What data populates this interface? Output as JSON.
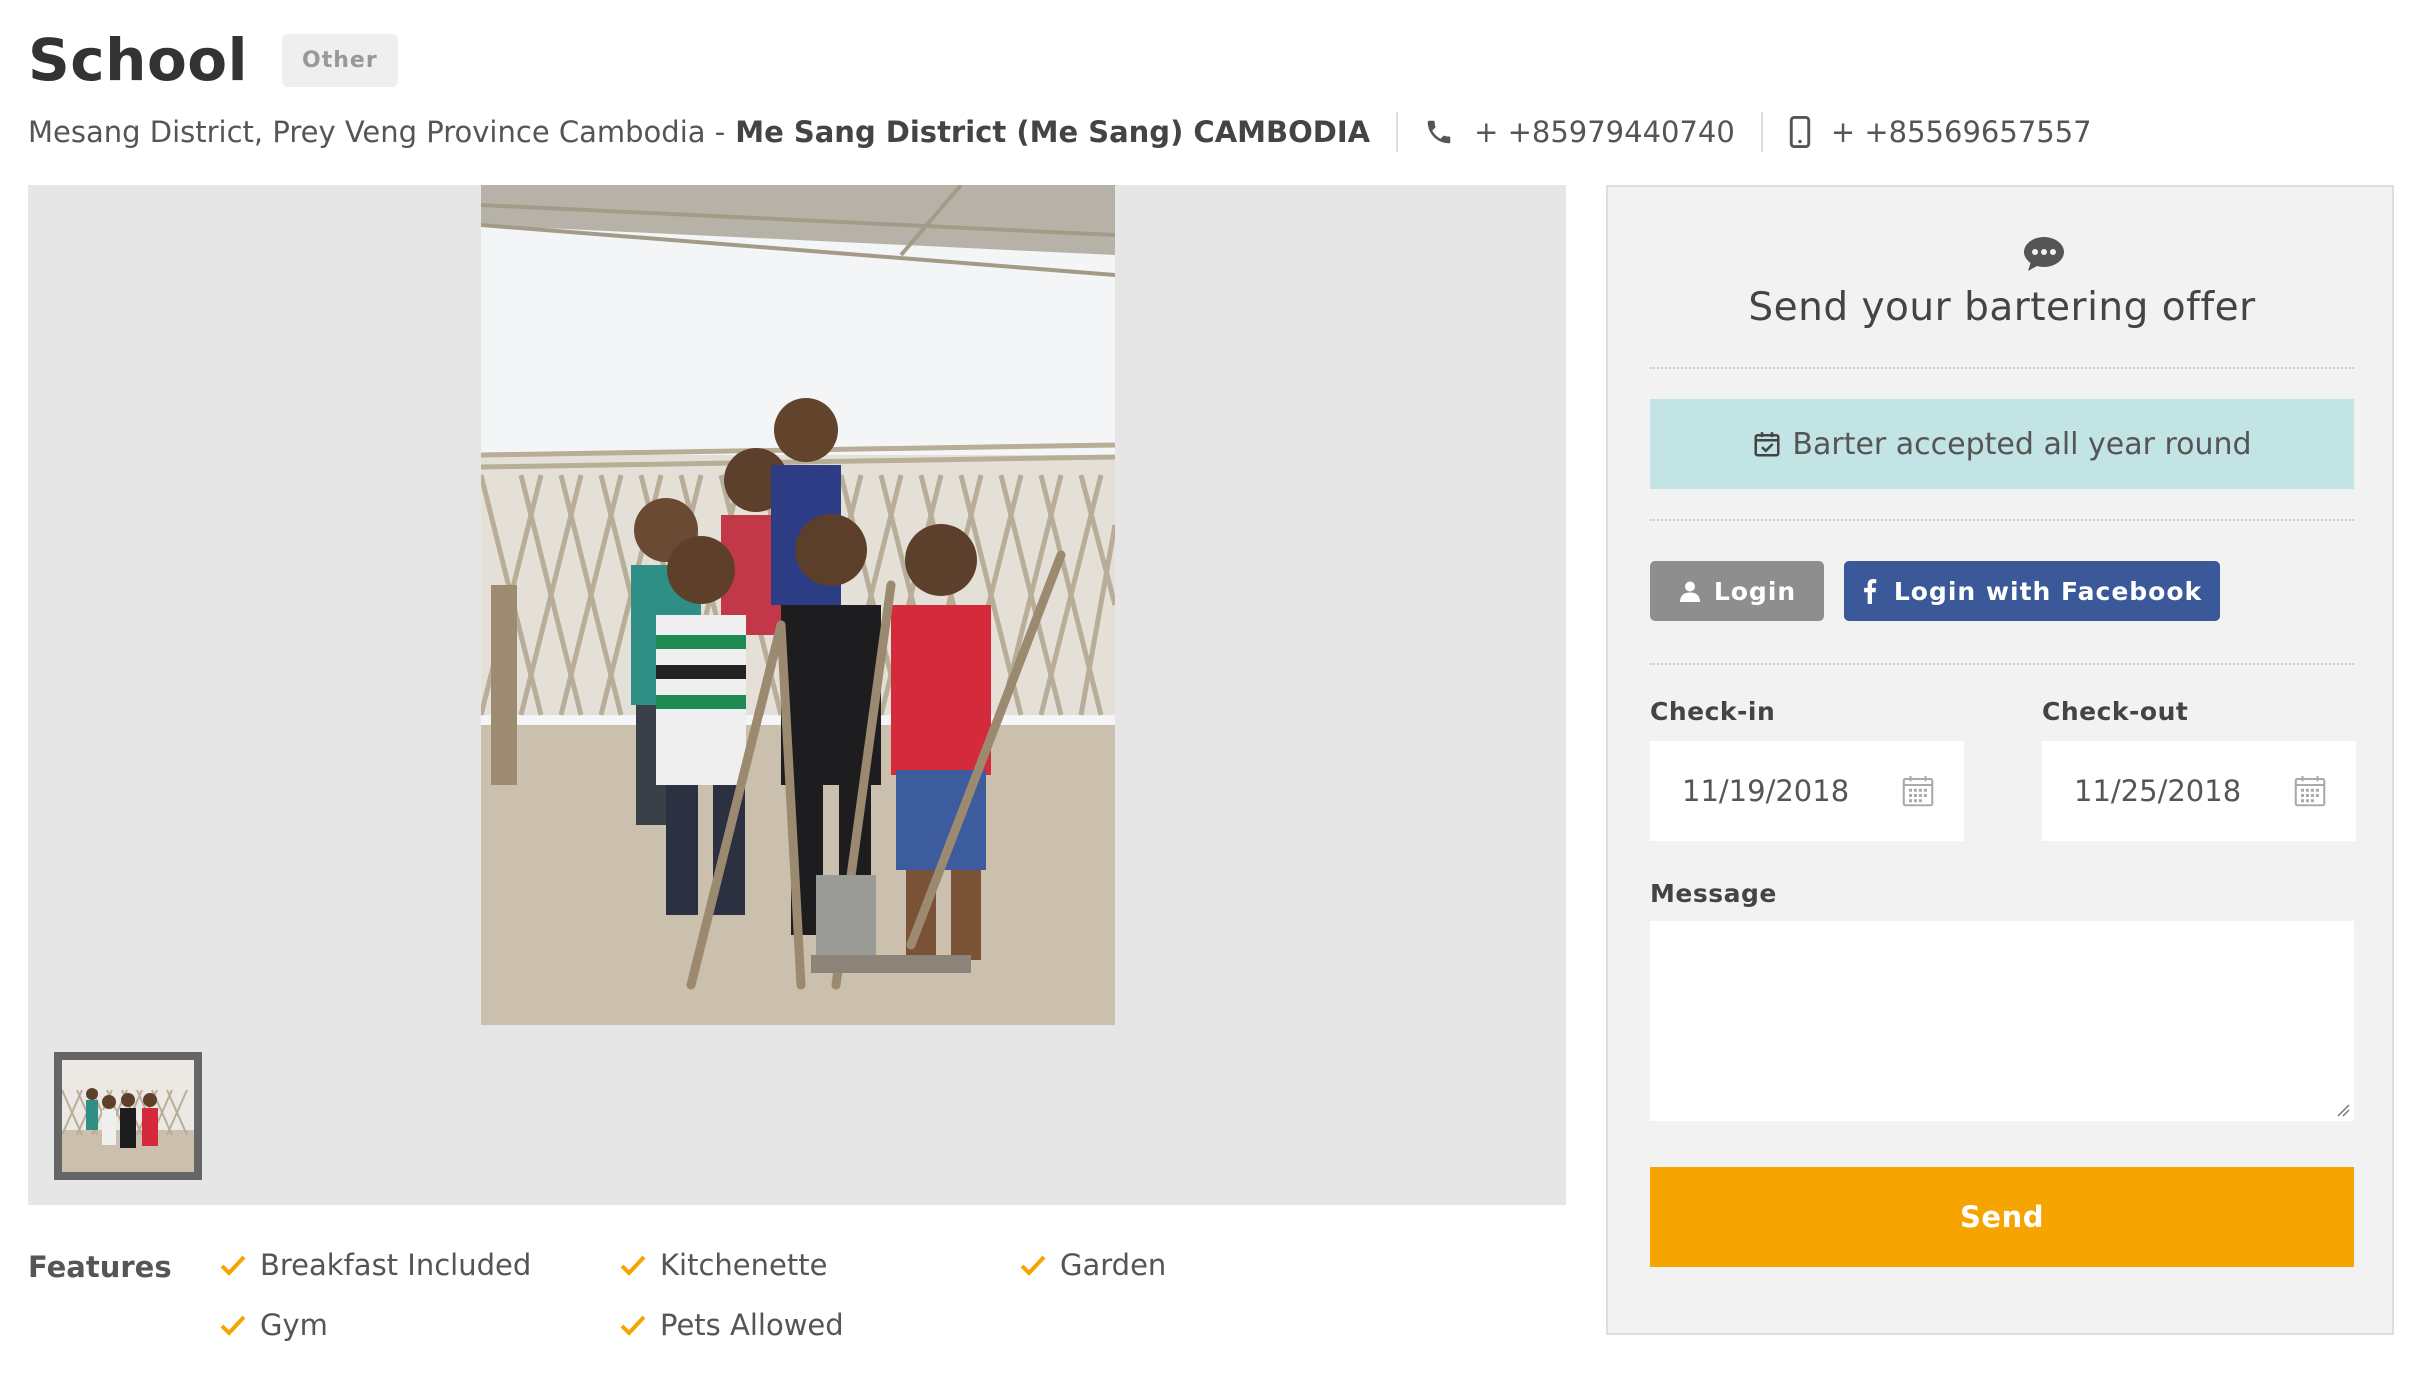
{
  "listing": {
    "title": "School",
    "type_badge": "Other",
    "address": "Mesang District, Prey Veng Province Cambodia -",
    "location": "Me Sang District (Me Sang) CAMBODIA",
    "phone": "+ +85979440740",
    "mobile": "+ +85569657557"
  },
  "features": {
    "label": "Features",
    "items": [
      "Breakfast Included",
      "Kitchenette",
      "Garden",
      "Gym",
      "Pets Allowed"
    ]
  },
  "sidebar": {
    "title": "Send your bartering offer",
    "availability": "Barter accepted all year round",
    "login_label": "Login",
    "facebook_label": "Login with Facebook",
    "checkin_label": "Check-in",
    "checkin_value": "11/19/2018",
    "checkout_label": "Check-out",
    "checkout_value": "11/25/2018",
    "message_label": "Message",
    "message_value": "",
    "send_label": "Send"
  },
  "colors": {
    "accent": "#f6a500",
    "facebook": "#3b5998",
    "availability_bg": "#c2e4e4",
    "feature_check": "#f6a500"
  },
  "icons": [
    "phone-icon",
    "mobile-icon",
    "chat-icon",
    "calendar-check-icon",
    "user-icon",
    "facebook-icon",
    "calendar-icon",
    "check-icon"
  ]
}
